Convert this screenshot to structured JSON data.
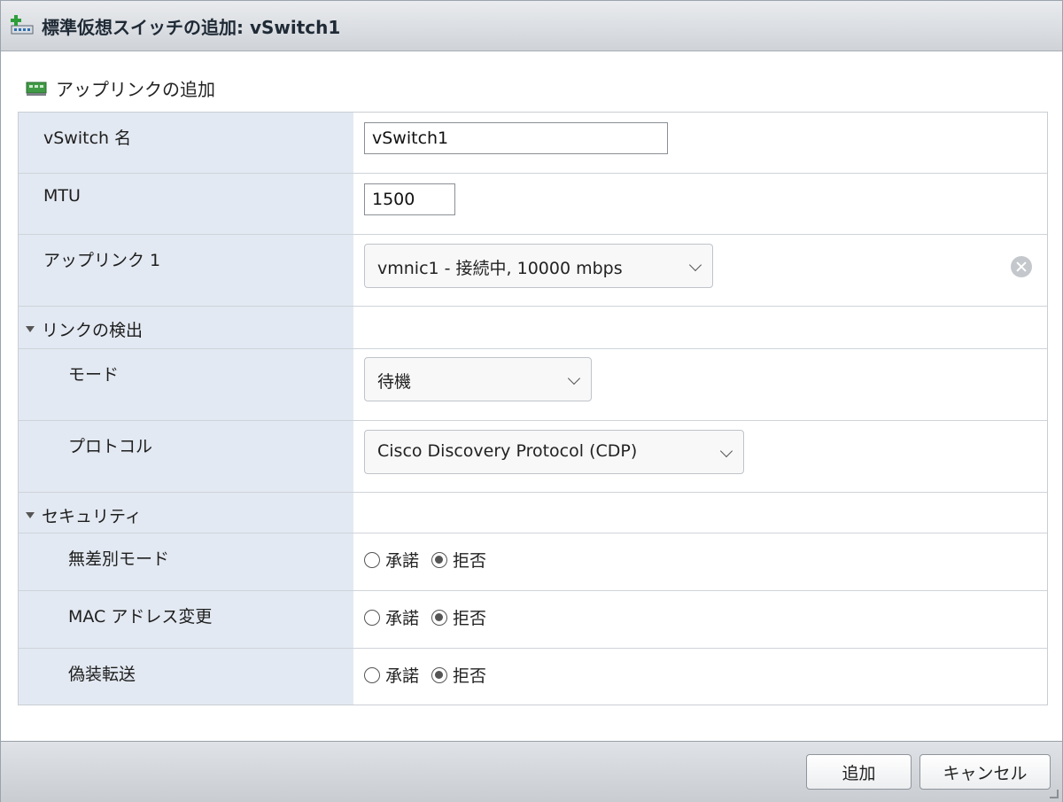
{
  "dialog": {
    "title": "標準仮想スイッチの追加: vSwitch1"
  },
  "section": {
    "add_uplink": "アップリンクの追加"
  },
  "fields": {
    "vswitch_name": {
      "label": "vSwitch 名",
      "value": "vSwitch1"
    },
    "mtu": {
      "label": "MTU",
      "value": "1500"
    },
    "uplink1": {
      "label": "アップリンク 1",
      "value": "vmnic1 - 接続中, 10000 mbps"
    }
  },
  "link_discovery": {
    "label": "リンクの検出",
    "mode": {
      "label": "モード",
      "value": "待機"
    },
    "protocol": {
      "label": "プロトコル",
      "value": "Cisco Discovery Protocol (CDP)"
    }
  },
  "security": {
    "label": "セキュリティ",
    "accept_label": "承諾",
    "reject_label": "拒否",
    "promiscuous": {
      "label": "無差別モード",
      "selected": "reject"
    },
    "mac_change": {
      "label": "MAC アドレス変更",
      "selected": "reject"
    },
    "forged": {
      "label": "偽装転送",
      "selected": "reject"
    }
  },
  "footer": {
    "add_button": "追加",
    "cancel_button": "キャンセル"
  },
  "icons": [
    "vswitch-add-icon",
    "uplink-nic-icon",
    "clear-icon",
    "chevron-down-icon",
    "triangle-down-icon",
    "resize-grip-icon"
  ]
}
